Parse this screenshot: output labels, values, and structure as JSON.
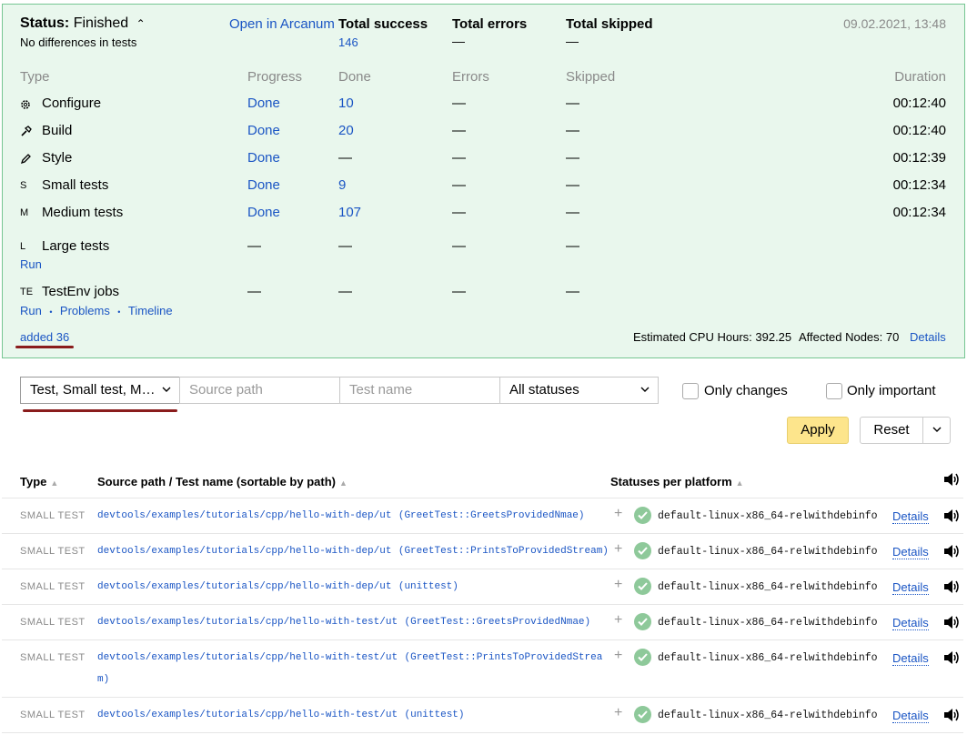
{
  "summary": {
    "status_label": "Status:",
    "status_value": "Finished",
    "status_sub": "No differences in tests",
    "open_link": "Open in Arcanum",
    "total_success_label": "Total success",
    "total_success_value": "146",
    "total_errors_label": "Total errors",
    "total_errors_value": "—",
    "total_skipped_label": "Total skipped",
    "total_skipped_value": "—",
    "datetime": "09.02.2021, 13:48",
    "columns": {
      "type": "Type",
      "progress": "Progress",
      "done": "Done",
      "errors": "Errors",
      "skipped": "Skipped",
      "duration": "Duration"
    },
    "rows": [
      {
        "icon": "gear-icon",
        "name": "Configure",
        "progress": "Done",
        "done": "10",
        "errors": "—",
        "skipped": "—",
        "duration": "00:12:40"
      },
      {
        "icon": "hammer-icon",
        "name": "Build",
        "progress": "Done",
        "done": "20",
        "errors": "—",
        "skipped": "—",
        "duration": "00:12:40"
      },
      {
        "icon": "pencil-icon",
        "name": "Style",
        "progress": "Done",
        "done": "—",
        "errors": "—",
        "skipped": "—",
        "duration": "00:12:39"
      },
      {
        "icon_text": "S",
        "name": "Small tests",
        "progress": "Done",
        "done": "9",
        "errors": "—",
        "skipped": "—",
        "duration": "00:12:34"
      },
      {
        "icon_text": "M",
        "name": "Medium tests",
        "progress": "Done",
        "done": "107",
        "errors": "—",
        "skipped": "—",
        "duration": "00:12:34"
      },
      {
        "icon_text": "L",
        "name": "Large tests",
        "progress": "—",
        "done": "—",
        "errors": "—",
        "skipped": "—",
        "links": [
          "Run"
        ]
      },
      {
        "icon_text": "TE",
        "name": "TestEnv jobs",
        "progress": "—",
        "done": "—",
        "errors": "—",
        "skipped": "—",
        "links": [
          "Run",
          "Problems",
          "Timeline"
        ]
      }
    ],
    "link_sep": "•",
    "added_link": "added 36",
    "cpu_hours": "Estimated CPU Hours: 392.25",
    "affected_nodes": "Affected Nodes: 70",
    "details_link": "Details"
  },
  "filters": {
    "type_select": "Test, Small test, M…",
    "source_path_placeholder": "Source path",
    "test_name_placeholder": "Test name",
    "status_select": "All statuses",
    "only_changes": "Only changes",
    "only_important": "Only important",
    "apply": "Apply",
    "reset": "Reset"
  },
  "table": {
    "headers": {
      "type": "Type",
      "path": "Source path / Test name (sortable by path)",
      "statuses": "Statuses per platform"
    },
    "rows": [
      {
        "type": "SMALL TEST",
        "path": "devtools/examples/tutorials/cpp/hello-with-dep/ut",
        "name": "(GreetTest::GreetsProvidedNmae)",
        "platform": "default-linux-x86_64-relwithdebinfo",
        "details": "Details"
      },
      {
        "type": "SMALL TEST",
        "path": "devtools/examples/tutorials/cpp/hello-with-dep/ut",
        "name": "(GreetTest::PrintsToProvidedStream)",
        "platform": "default-linux-x86_64-relwithdebinfo",
        "details": "Details"
      },
      {
        "type": "SMALL TEST",
        "path": "devtools/examples/tutorials/cpp/hello-with-dep/ut",
        "name": "(unittest)",
        "platform": "default-linux-x86_64-relwithdebinfo",
        "details": "Details"
      },
      {
        "type": "SMALL TEST",
        "path": "devtools/examples/tutorials/cpp/hello-with-test/ut",
        "name": "(GreetTest::GreetsProvidedNmae)",
        "platform": "default-linux-x86_64-relwithdebinfo",
        "details": "Details"
      },
      {
        "type": "SMALL TEST",
        "path": "devtools/examples/tutorials/cpp/hello-with-test/ut",
        "name": "(GreetTest::PrintsToProvidedStrea",
        "name_cont": "m)",
        "platform": "default-linux-x86_64-relwithdebinfo",
        "details": "Details"
      },
      {
        "type": "SMALL TEST",
        "path": "devtools/examples/tutorials/cpp/hello-with-test/ut",
        "name": "(unittest)",
        "platform": "default-linux-x86_64-relwithdebinfo",
        "details": "Details"
      }
    ]
  },
  "colors": {
    "panel_bg": "#e9f7ed",
    "panel_border": "#76c693",
    "link": "#1a55c4",
    "ok": "#8ec99a",
    "apply_bg": "#fde58c",
    "annotation": "#8a1c1c"
  }
}
